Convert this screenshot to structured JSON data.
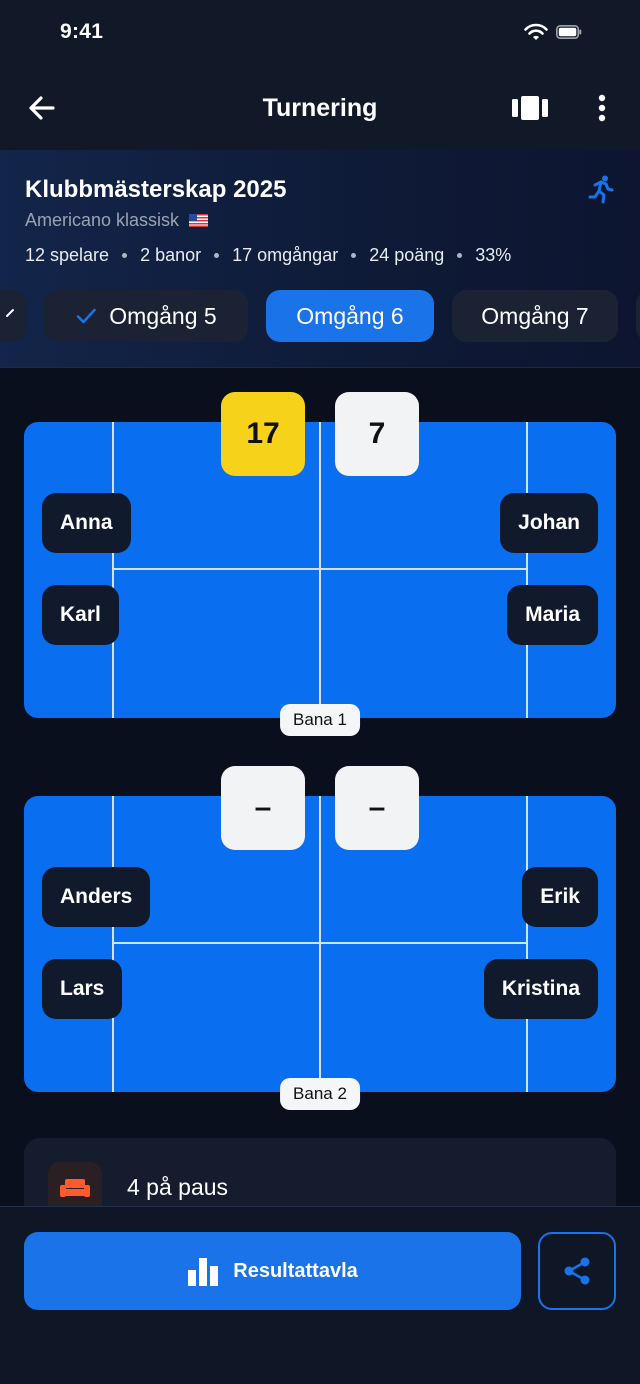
{
  "status_bar": {
    "time": "9:41"
  },
  "nav": {
    "title": "Turnering"
  },
  "tournament": {
    "name": "Klubbmästerskap 2025",
    "format": "Americano klassisk",
    "stats": [
      "12 spelare",
      "2 banor",
      "17 omgångar",
      "24 poäng",
      "33%"
    ]
  },
  "rounds": {
    "tabs": [
      {
        "label": "Omgång 5",
        "completed": true
      },
      {
        "label": "Omgång 6",
        "active": true
      },
      {
        "label": "Omgång 7"
      }
    ]
  },
  "courts": [
    {
      "label": "Bana 1",
      "score_left": "17",
      "score_right": "7",
      "left_players": [
        "Anna",
        "Karl"
      ],
      "right_players": [
        "Johan",
        "Maria"
      ]
    },
    {
      "label": "Bana 2",
      "score_left": "–",
      "score_right": "–",
      "left_players": [
        "Anders",
        "Lars"
      ],
      "right_players": [
        "Erik",
        "Kristina"
      ]
    }
  ],
  "pause": {
    "text": "4 på paus"
  },
  "bottom": {
    "leaderboard_label": "Resultattavla"
  },
  "colors": {
    "accent": "#1a73e8",
    "court": "#0a6ef0",
    "winner_score": "#f6d21b",
    "pause_icon": "#ff5a2c"
  }
}
